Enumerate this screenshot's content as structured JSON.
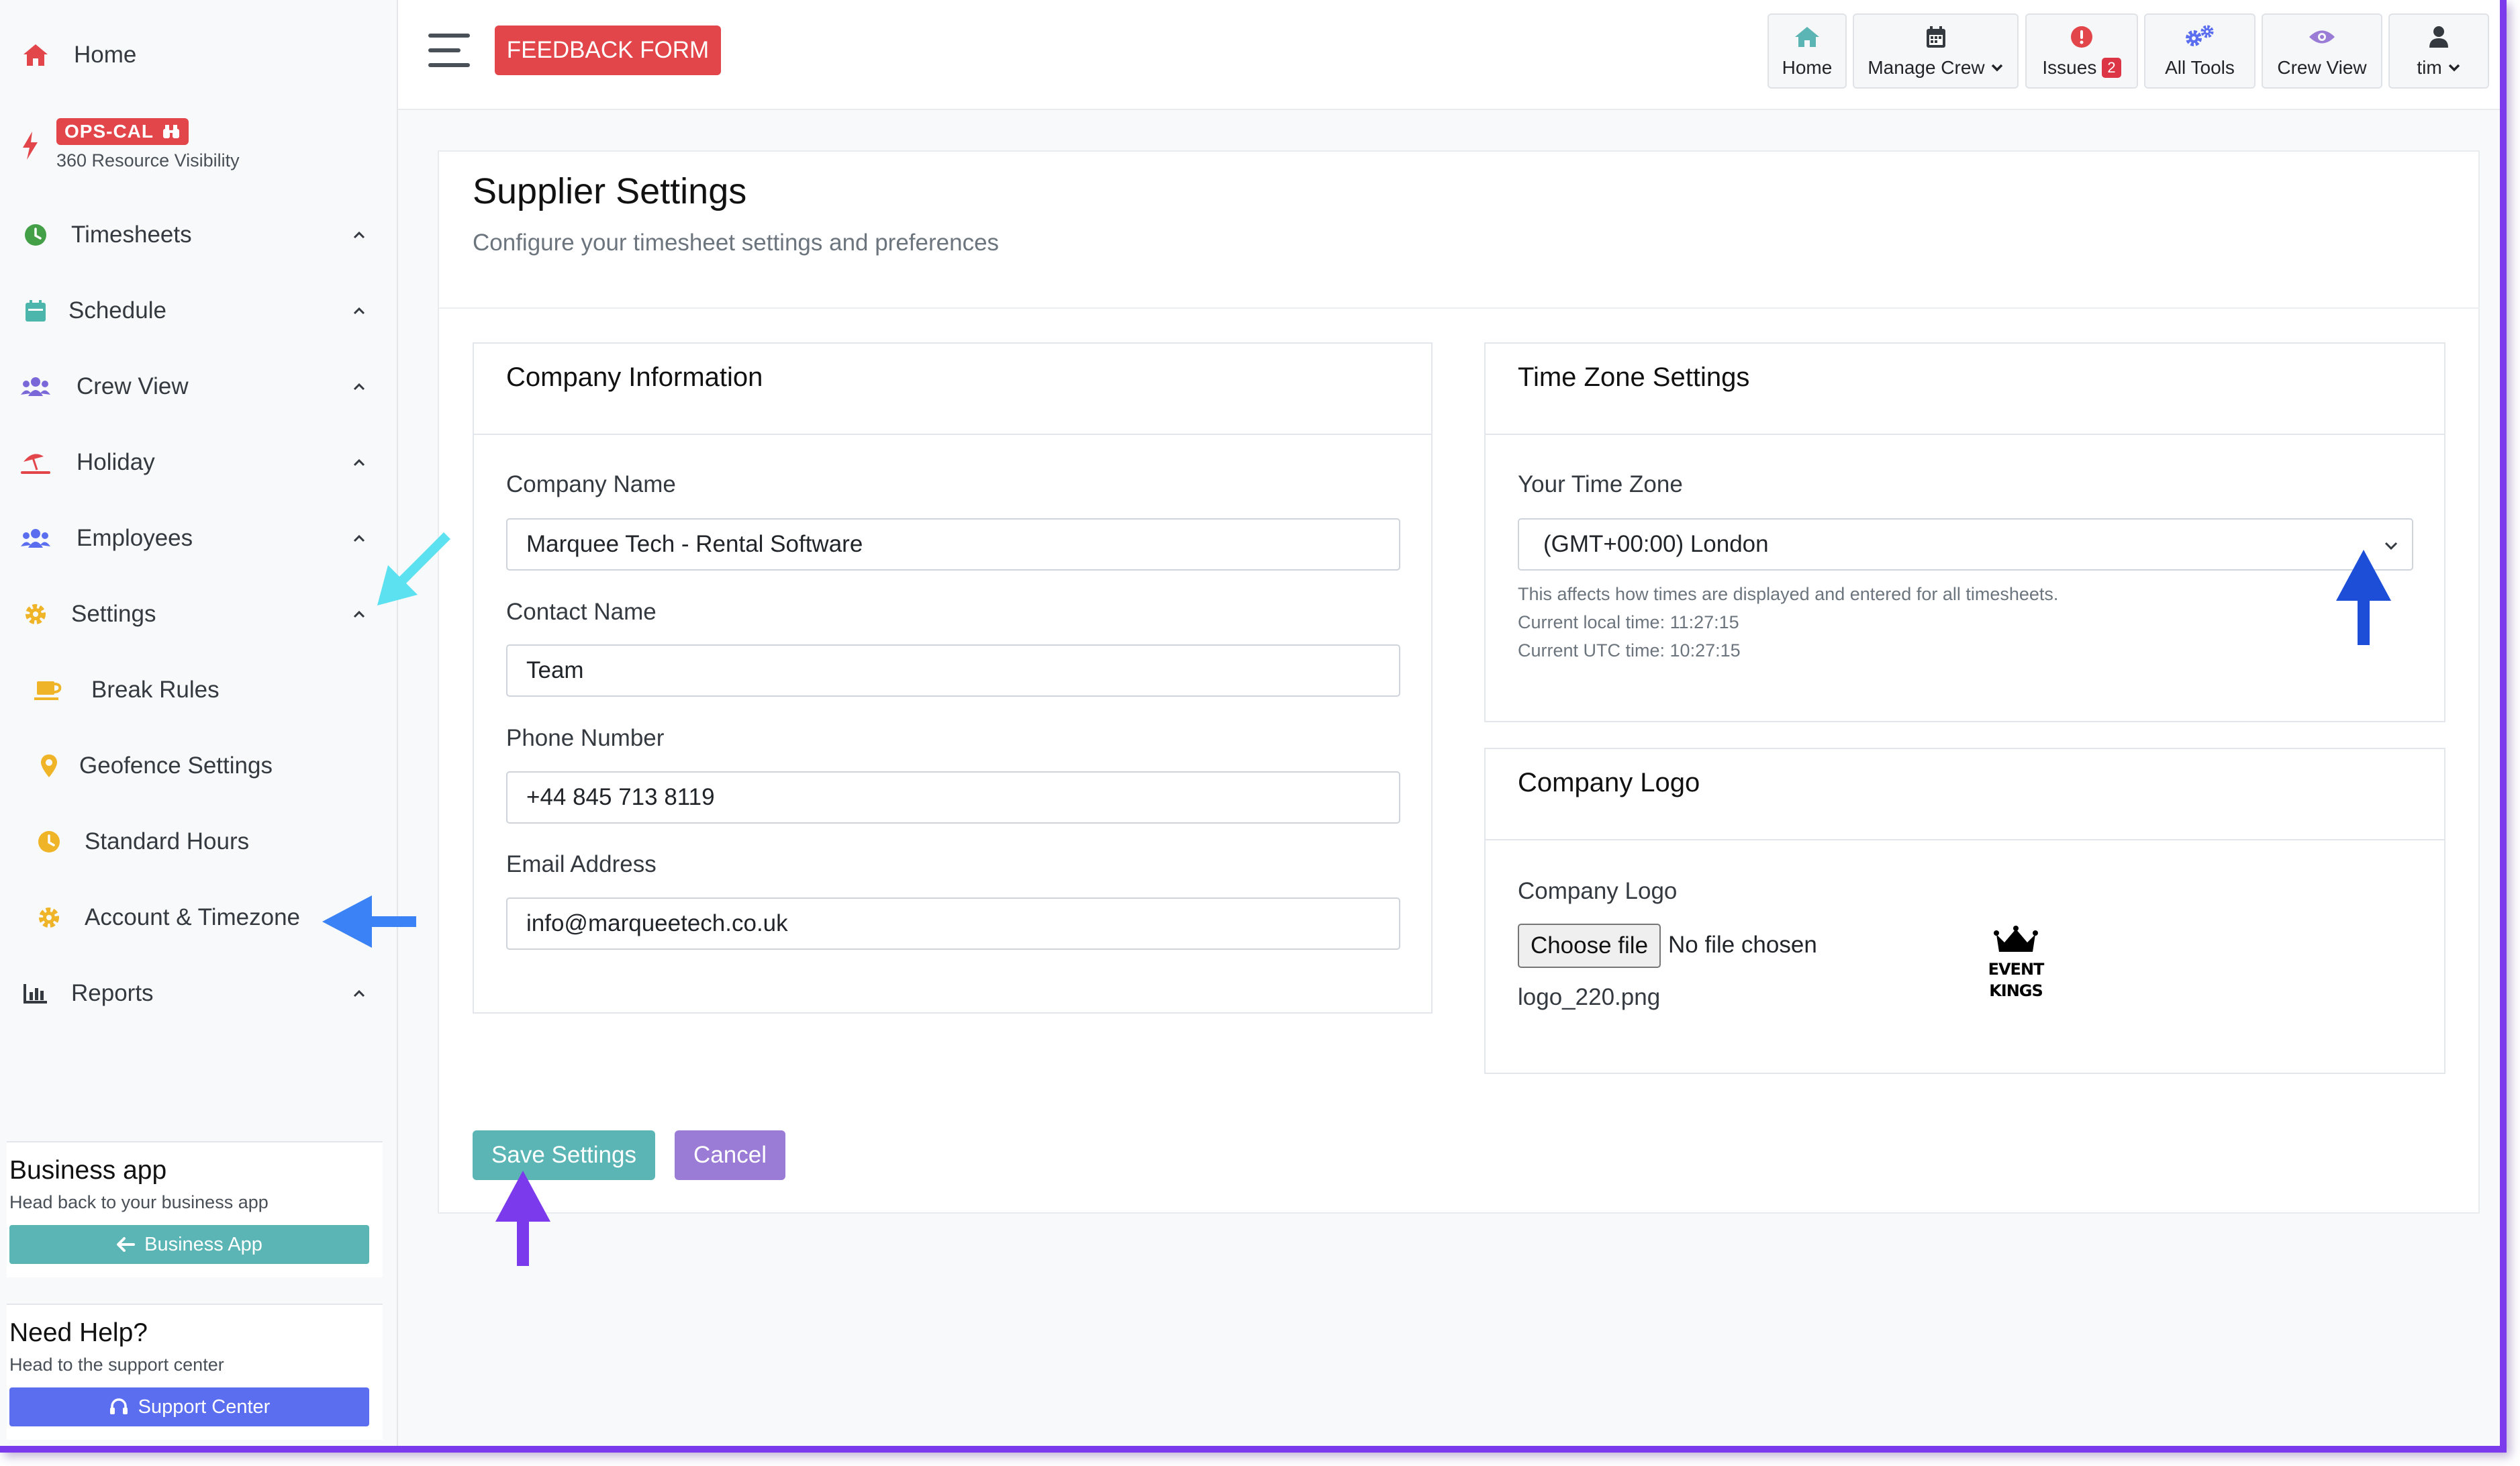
{
  "sidebar": {
    "home_label": "Home",
    "ops_cal": {
      "badge": "OPS-CAL",
      "subtitle": "360 Resource Visibility"
    },
    "items": [
      {
        "label": "Timesheets"
      },
      {
        "label": "Schedule"
      },
      {
        "label": "Crew View"
      },
      {
        "label": "Holiday"
      },
      {
        "label": "Employees"
      },
      {
        "label": "Settings"
      },
      {
        "label": "Break Rules"
      },
      {
        "label": "Geofence Settings"
      },
      {
        "label": "Standard Hours"
      },
      {
        "label": "Account & Timezone"
      },
      {
        "label": "Reports"
      }
    ],
    "business_app": {
      "title": "Business app",
      "subtitle": "Head back to your business app",
      "button": "Business App"
    },
    "need_help": {
      "title": "Need Help?",
      "subtitle": "Head to the support center",
      "button": "Support Center"
    }
  },
  "topbar": {
    "feedback_label": "FEEDBACK FORM",
    "tools": {
      "home": "Home",
      "manage_crew": "Manage Crew",
      "issues": "Issues",
      "issues_count": "2",
      "all_tools": "All Tools",
      "crew_view": "Crew View",
      "user": "tim"
    }
  },
  "page": {
    "title": "Supplier Settings",
    "subtitle": "Configure your timesheet settings and preferences"
  },
  "company_info": {
    "title": "Company Information",
    "company_name_label": "Company Name",
    "company_name_value": "Marquee Tech - Rental Software",
    "contact_name_label": "Contact Name",
    "contact_name_value": "Team",
    "phone_label": "Phone Number",
    "phone_value": "+44 845 713 8119",
    "email_label": "Email Address",
    "email_value": "info@marqueetech.co.uk"
  },
  "timezone": {
    "title": "Time Zone Settings",
    "label": "Your Time Zone",
    "selected": "(GMT+00:00) London",
    "help": "This affects how times are displayed and entered for all timesheets.",
    "local_time": "Current local time: 11:27:15",
    "utc_time": "Current UTC time: 10:27:15"
  },
  "company_logo": {
    "title": "Company Logo",
    "label": "Company Logo",
    "choose_file": "Choose file",
    "no_file": "No file chosen",
    "current_file": "logo_220.png",
    "logo_text_1": "EVENT",
    "logo_text_2": "KINGS"
  },
  "actions": {
    "save": "Save Settings",
    "cancel": "Cancel"
  },
  "colors": {
    "accent_red": "#e2464a",
    "save_teal": "#5bb5b5",
    "cancel_purple": "#9a7bd6",
    "business_btn": "#5bb5b5",
    "support_btn": "#5b6ef0",
    "frame_purple": "#7c3aed"
  }
}
